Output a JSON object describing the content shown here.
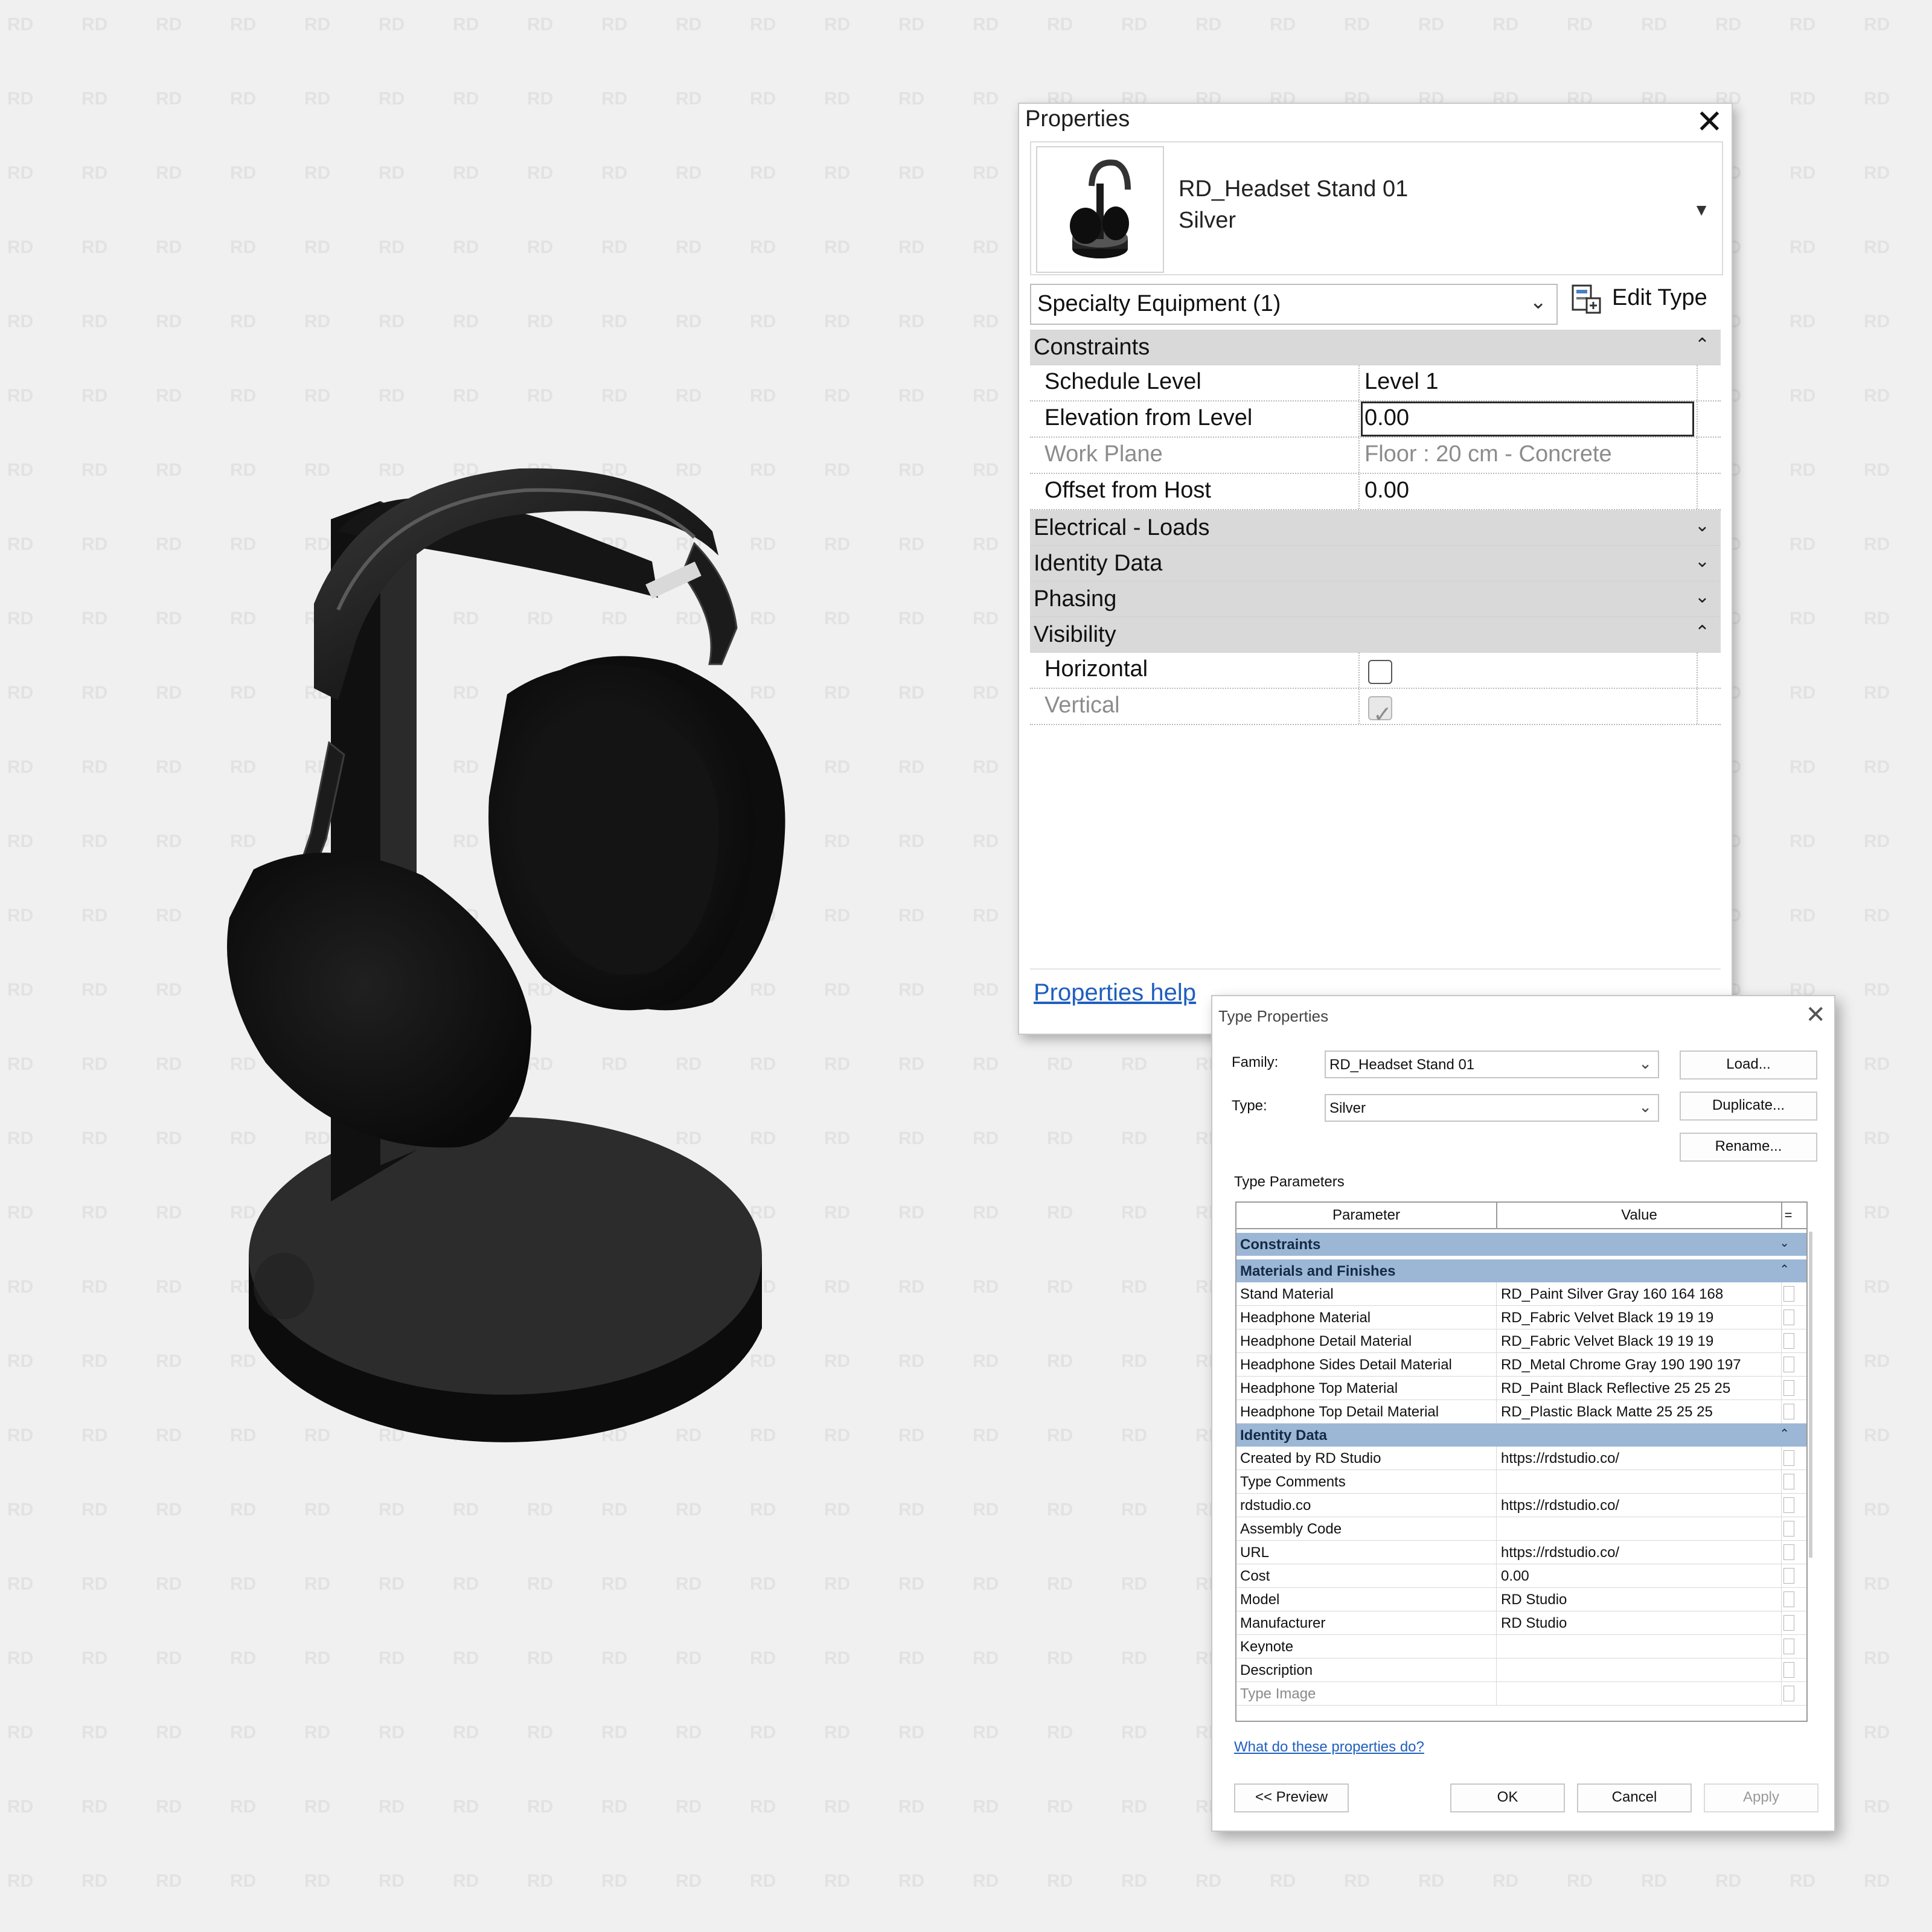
{
  "watermark_text": "RD",
  "properties": {
    "title": "Properties",
    "close_glyph": "✕",
    "type_selector": {
      "family_name": "RD_Headset Stand 01",
      "type_name": "Silver",
      "dropdown_glyph": "▼"
    },
    "category_filter": "Specialty Equipment (1)",
    "edit_type_label": "Edit Type",
    "groups": {
      "constraints": {
        "label": "Constraints",
        "rows": [
          {
            "name": "Schedule Level",
            "value": "Level 1"
          },
          {
            "name": "Elevation from Level",
            "value": "0.00"
          },
          {
            "name": "Work Plane",
            "value": "Floor : 20 cm - Concrete"
          },
          {
            "name": "Offset from Host",
            "value": "0.00"
          }
        ]
      },
      "electrical": {
        "label": "Electrical - Loads"
      },
      "identity": {
        "label": "Identity Data"
      },
      "phasing": {
        "label": "Phasing"
      },
      "visibility": {
        "label": "Visibility",
        "rows": [
          {
            "name": "Horizontal",
            "checked": false
          },
          {
            "name": "Vertical",
            "checked": true
          }
        ]
      }
    },
    "help_link": "Properties help"
  },
  "type_properties": {
    "title": "Type Properties",
    "close_glyph": "✕",
    "family_label": "Family:",
    "family_value": "RD_Headset Stand 01",
    "type_label": "Type:",
    "type_value": "Silver",
    "load_button": "Load...",
    "duplicate_button": "Duplicate...",
    "rename_button": "Rename...",
    "type_parameters_title": "Type Parameters",
    "columns": {
      "parameter": "Parameter",
      "value": "Value",
      "extra": "="
    },
    "groups": {
      "constraints": {
        "label": "Constraints"
      },
      "materials": {
        "label": "Materials and Finishes",
        "rows": [
          {
            "name": "Stand Material",
            "value": "RD_Paint Silver Gray 160 164 168"
          },
          {
            "name": "Headphone Material",
            "value": "RD_Fabric Velvet Black 19 19 19"
          },
          {
            "name": "Headphone Detail Material",
            "value": "RD_Fabric Velvet Black 19 19 19"
          },
          {
            "name": "Headphone Sides Detail Material",
            "value": "RD_Metal Chrome Gray 190 190 197"
          },
          {
            "name": "Headphone Top Material",
            "value": "RD_Paint Black Reflective 25 25 25"
          },
          {
            "name": "Headphone Top Detail Material",
            "value": "RD_Plastic Black Matte 25 25 25"
          }
        ]
      },
      "identity": {
        "label": "Identity Data",
        "rows": [
          {
            "name": "Created by RD Studio",
            "value": "https://rdstudio.co/"
          },
          {
            "name": "Type Comments",
            "value": ""
          },
          {
            "name": "rdstudio.co",
            "value": "https://rdstudio.co/"
          },
          {
            "name": "Assembly Code",
            "value": ""
          },
          {
            "name": "URL",
            "value": "https://rdstudio.co/"
          },
          {
            "name": "Cost",
            "value": "0.00"
          },
          {
            "name": "Model",
            "value": "RD Studio"
          },
          {
            "name": "Manufacturer",
            "value": "RD Studio"
          },
          {
            "name": "Keynote",
            "value": ""
          },
          {
            "name": "Description",
            "value": ""
          },
          {
            "name": "Type Image",
            "value": ""
          }
        ]
      }
    },
    "help_link": "What do these properties do?",
    "preview_button": "<< Preview",
    "ok_button": "OK",
    "cancel_button": "Cancel",
    "apply_button": "Apply"
  },
  "colors": {
    "background": "#f0f0f0",
    "watermark": "#e2e2e2",
    "group_header_gray": "#d9d9d9",
    "group_header_blue": "#9cb6d6",
    "link_blue": "#1f5fbf",
    "model_black": "#1a1a1a"
  },
  "icons": {
    "collapse": "collapse-chevrons-up-icon",
    "expand": "expand-chevrons-down-icon",
    "dropdown": "chevron-down-icon",
    "close": "close-icon",
    "edit_type": "edit-type-icon",
    "checkmark": "checkmark-icon"
  }
}
